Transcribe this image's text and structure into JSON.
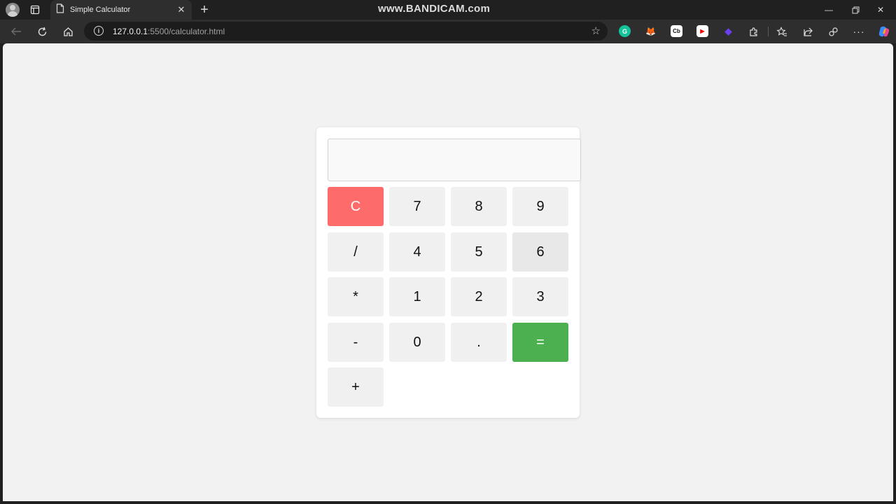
{
  "browser": {
    "tab_title": "Simple Calculator",
    "url_host": "127.0.0.1",
    "url_rest": ":5500/calculator.html",
    "watermark": "www.BANDICAM.com",
    "extensions": [
      {
        "name": "grammarly-extension-icon",
        "label": "G",
        "color": "#15c39a"
      },
      {
        "name": "metamask-extension-icon",
        "label": "🦊",
        "color": "#e2761b"
      },
      {
        "name": "cb-extension-icon",
        "label": "Cb",
        "color": "#ffffff"
      },
      {
        "name": "youtube-extension-icon",
        "label": "▶",
        "color": "#ff0000"
      },
      {
        "name": "purple-extension-icon",
        "label": "◆",
        "color": "#5b2fd6"
      }
    ]
  },
  "calculator": {
    "display_value": "",
    "keys": {
      "clear": "C",
      "seven": "7",
      "eight": "8",
      "nine": "9",
      "divide": "/",
      "four": "4",
      "five": "5",
      "six": "6",
      "multiply": "*",
      "one": "1",
      "two": "2",
      "three": "3",
      "subtract": "-",
      "zero": "0",
      "decimal": ".",
      "equals": "=",
      "add": "+"
    },
    "colors": {
      "clear": "#fe6b6b",
      "equals": "#4caf50",
      "key": "#f0f0f0",
      "page_background": "#f2f2f2"
    }
  }
}
